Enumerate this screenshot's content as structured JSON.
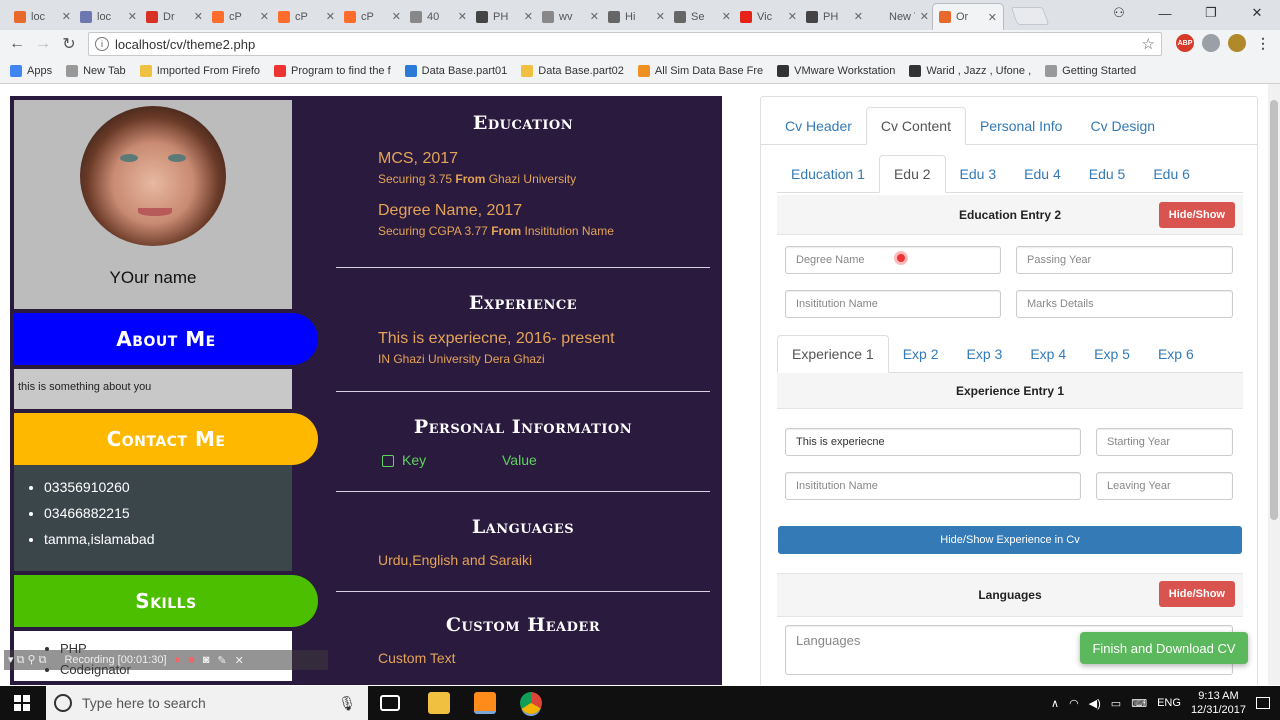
{
  "browser": {
    "tabs": [
      {
        "label": "loc",
        "color": "#e8692c"
      },
      {
        "label": "loc",
        "color": "#6c78af"
      },
      {
        "label": "Dr",
        "color": "#d93025"
      },
      {
        "label": "cP",
        "color": "#ff6c2c"
      },
      {
        "label": "cP",
        "color": "#ff6c2c"
      },
      {
        "label": "cP",
        "color": "#ff6c2c"
      },
      {
        "label": "40",
        "color": "#888888"
      },
      {
        "label": "PH",
        "color": "#444444"
      },
      {
        "label": "wv",
        "color": "#888888"
      },
      {
        "label": "Hi",
        "color": "#666666"
      },
      {
        "label": "Se",
        "color": "#666666"
      },
      {
        "label": "Vic",
        "color": "#e62117"
      },
      {
        "label": "PH",
        "color": "#444444"
      },
      {
        "label": "New Ta",
        "color": "#dee1e6"
      },
      {
        "label": "Or",
        "color": "#e8692c"
      }
    ],
    "url": "localhost/cv/theme2.php",
    "bookmarks": [
      "Apps",
      "New Tab",
      "Imported From Firefo",
      "Program to find the f",
      "Data Base.part01",
      "Data Base.part02",
      "All Sim Data Base Fre",
      "VMware Workstation",
      "Warid , Jazz , Ufone ,",
      "Getting Started"
    ]
  },
  "cv": {
    "name": "YOur name",
    "about_title": "About Me",
    "about_text": "this is something about you",
    "contact_title": "Contact Me",
    "contacts": [
      "03356910260",
      "03466882215",
      "tamma,islamabad"
    ],
    "skills_title": "Skills",
    "skills": [
      "PHP",
      "Codeignator"
    ],
    "education_title": "Education",
    "education": [
      {
        "title": "MCS, 2017",
        "detail_pre": "Securing 3.75 ",
        "from": "From",
        "detail_post": " Ghazi University"
      },
      {
        "title": "Degree Name, 2017",
        "detail_pre": "Securing CGPA 3.77 ",
        "from": "From",
        "detail_post": " Insititution Name"
      }
    ],
    "experience_title": "Experience",
    "experience": {
      "title": "This is experiecne, 2016- present",
      "detail": "IN Ghazi University Dera Ghazi"
    },
    "personal_title": "Personal Information",
    "personal": {
      "key": "Key",
      "value": "Value"
    },
    "languages_title": "Languages",
    "languages": "Urdu,English and Saraiki",
    "custom_title": "Custom Header",
    "custom_text": "Custom Text",
    "colors": {
      "about": "#0000ff",
      "contact": "#ffb800",
      "skills": "#4cbf00"
    }
  },
  "form": {
    "main_tabs": [
      "Cv Header",
      "Cv Content",
      "Personal Info",
      "Cv Design"
    ],
    "edu_tabs": [
      "Education 1",
      "Edu 2",
      "Edu 3",
      "Edu 4",
      "Edu 5",
      "Edu 6"
    ],
    "edu_heading": "Education Entry 2",
    "hide_show": "Hide/Show",
    "degree_ph": "Degree Name",
    "passing_ph": "Passing Year",
    "institution_ph": "Insititution Name",
    "marks_ph": "Marks Details",
    "exp_tabs": [
      "Experience 1",
      "Exp 2",
      "Exp 3",
      "Exp 4",
      "Exp 5",
      "Exp 6"
    ],
    "exp_heading": "Experience Entry 1",
    "exp_title_value": "This is experiecne",
    "starting_ph": "Starting Year",
    "exp_institution_ph": "Insititution Name",
    "leaving_ph": "Leaving Year",
    "hide_show_exp": "Hide/Show Experience in Cv",
    "languages_heading": "Languages",
    "languages_ph": "Languages",
    "finish": "Finish and Download CV"
  },
  "recorder": {
    "label": "Recording [00:01:30]"
  },
  "taskbar": {
    "search": "Type here to search",
    "lang": "ENG",
    "time": "9:13 AM",
    "date": "12/31/2017"
  }
}
